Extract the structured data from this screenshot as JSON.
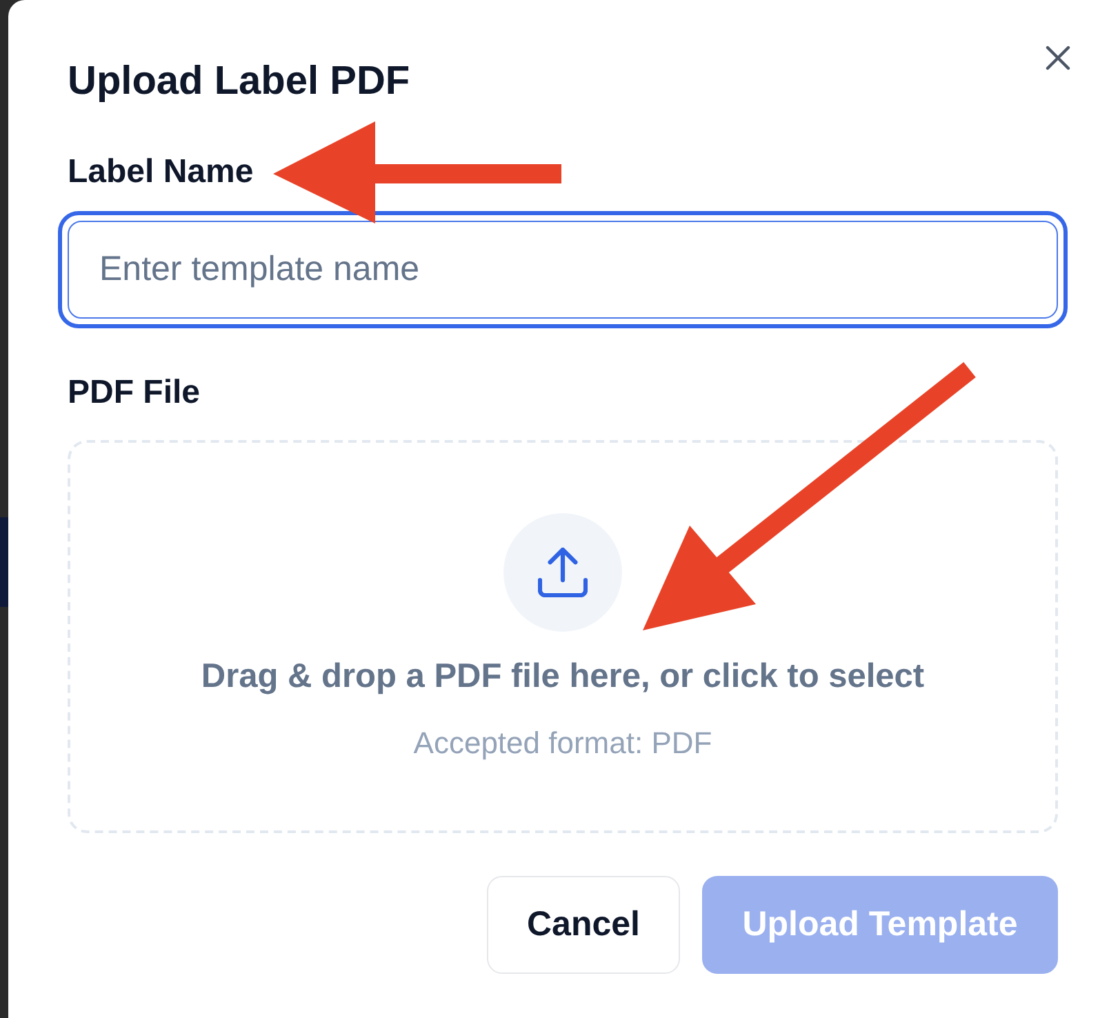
{
  "dialog": {
    "title": "Upload Label PDF"
  },
  "fields": [
    {
      "kind": "text",
      "label": "Label Name",
      "placeholder": "Enter template name",
      "focused": true
    },
    {
      "kind": "file",
      "label": "PDF File",
      "prompt": "Drag & drop a PDF file here, or click to select",
      "hint": "Accepted format: PDF"
    }
  ],
  "buttons": [
    {
      "kind": "secondary",
      "label": "Cancel",
      "disabled": false
    },
    {
      "kind": "primary",
      "label": "Upload Template",
      "disabled": true
    }
  ]
}
